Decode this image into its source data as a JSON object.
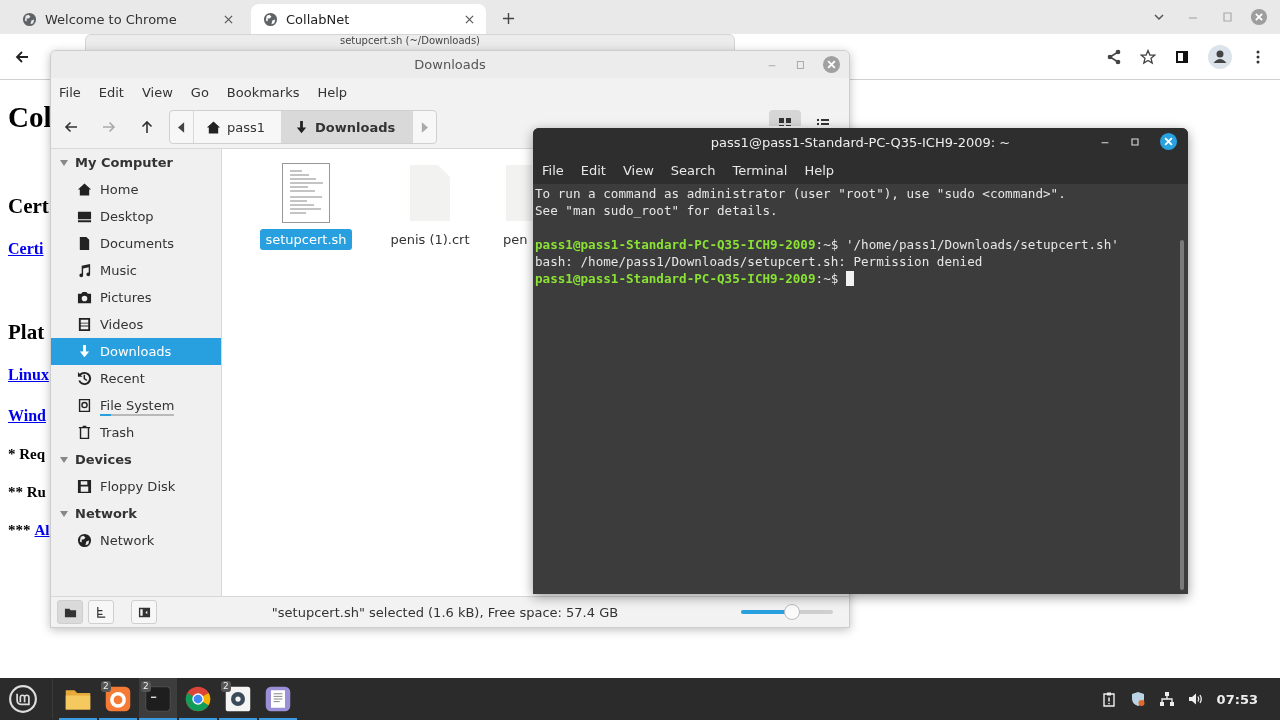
{
  "browser": {
    "tabs": [
      {
        "title": "Welcome to Chrome",
        "selected": false
      },
      {
        "title": "CollabNet",
        "selected": true
      }
    ],
    "page": [
      {
        "kind": "h1",
        "text": "Col"
      },
      {
        "kind": "h2",
        "text": "Cert"
      },
      {
        "kind": "link",
        "text": "Certi"
      },
      {
        "kind": "h2",
        "text": "Plat"
      },
      {
        "kind": "link",
        "text": "Linux"
      },
      {
        "kind": "link",
        "text": "Wind"
      },
      {
        "kind": "note",
        "text": "* Req"
      },
      {
        "kind": "note",
        "text": "** Ru"
      },
      {
        "kind": "note_link",
        "text": "***",
        "link": "Al"
      }
    ]
  },
  "editor_window": {
    "title": "setupcert.sh (~/Downloads)"
  },
  "file_manager": {
    "title": "Downloads",
    "menu": [
      "File",
      "Edit",
      "View",
      "Go",
      "Bookmarks",
      "Help"
    ],
    "breadcrumb": [
      {
        "label": "pass1",
        "kind": "home",
        "selected": false
      },
      {
        "label": "Downloads",
        "kind": "downloads",
        "selected": true
      }
    ],
    "view_modes": [
      {
        "kind": "icons",
        "selected": true
      },
      {
        "kind": "list",
        "selected": false
      }
    ],
    "sidebar": [
      {
        "heading": "My Computer",
        "expanded": true,
        "items": [
          {
            "label": "Home",
            "kind": "home",
            "selected": false
          },
          {
            "label": "Desktop",
            "kind": "desktop",
            "selected": false
          },
          {
            "label": "Documents",
            "kind": "documents",
            "selected": false
          },
          {
            "label": "Music",
            "kind": "music",
            "selected": false
          },
          {
            "label": "Pictures",
            "kind": "pictures",
            "selected": false
          },
          {
            "label": "Videos",
            "kind": "videos",
            "selected": false
          },
          {
            "label": "Downloads",
            "kind": "downloads",
            "selected": true
          },
          {
            "label": "Recent",
            "kind": "recent",
            "selected": false
          },
          {
            "label": "File System",
            "kind": "filesystem",
            "selected": false,
            "level": 0.15
          },
          {
            "label": "Trash",
            "kind": "trash",
            "selected": false
          }
        ]
      },
      {
        "heading": "Devices",
        "expanded": true,
        "items": [
          {
            "label": "Floppy Disk",
            "kind": "floppy",
            "selected": false
          }
        ]
      },
      {
        "heading": "Network",
        "expanded": true,
        "items": [
          {
            "label": "Network",
            "kind": "network",
            "selected": false
          }
        ]
      }
    ],
    "files": [
      {
        "name": "setupcert.sh",
        "kind": "script",
        "selected": true
      },
      {
        "name": "penis (1).crt",
        "kind": "blank",
        "selected": false
      },
      {
        "name": "pen",
        "kind": "blank",
        "selected": false
      }
    ],
    "status_buttons": [
      {
        "kind": "places",
        "selected": true
      },
      {
        "kind": "tree",
        "selected": false
      },
      {
        "kind": "sidebar",
        "selected": false
      }
    ],
    "status_text": "\"setupcert.sh\" selected (1.6 kB), Free space: 57.4 GB",
    "zoom": {
      "level": 0.55
    }
  },
  "terminal": {
    "title": "pass1@pass1-Standard-PC-Q35-ICH9-2009: ~",
    "menu": [
      "File",
      "Edit",
      "View",
      "Search",
      "Terminal",
      "Help"
    ],
    "lines": [
      {
        "kind": "output",
        "text": "To run a command as administrator (user \"root\"), use \"sudo <command>\"."
      },
      {
        "kind": "output",
        "text": "See \"man sudo_root\" for details."
      },
      {
        "kind": "blank"
      },
      {
        "kind": "prompt",
        "user": "pass1@pass1-Standard-PC-Q35-ICH9-2009",
        "path": ":~$",
        "command": "'/home/pass1/Downloads/setupcert.sh'",
        "cursor": false
      },
      {
        "kind": "output",
        "text": "bash: /home/pass1/Downloads/setupcert.sh: Permission denied"
      },
      {
        "kind": "prompt",
        "user": "pass1@pass1-Standard-PC-Q35-ICH9-2009",
        "path": ":~$",
        "cursor": true
      }
    ]
  },
  "taskbar": {
    "apps": [
      {
        "kind": "folder",
        "running": true,
        "selected": false
      },
      {
        "kind": "firefox",
        "running": true,
        "selected": false,
        "badge": "2"
      },
      {
        "kind": "terminal",
        "running": true,
        "selected": true,
        "badge": "2"
      },
      {
        "kind": "chrome",
        "running": true,
        "selected": false
      },
      {
        "kind": "settings",
        "running": true,
        "selected": false,
        "badge": "2"
      },
      {
        "kind": "editor",
        "running": true,
        "selected": false
      }
    ],
    "clock": "07:53"
  }
}
